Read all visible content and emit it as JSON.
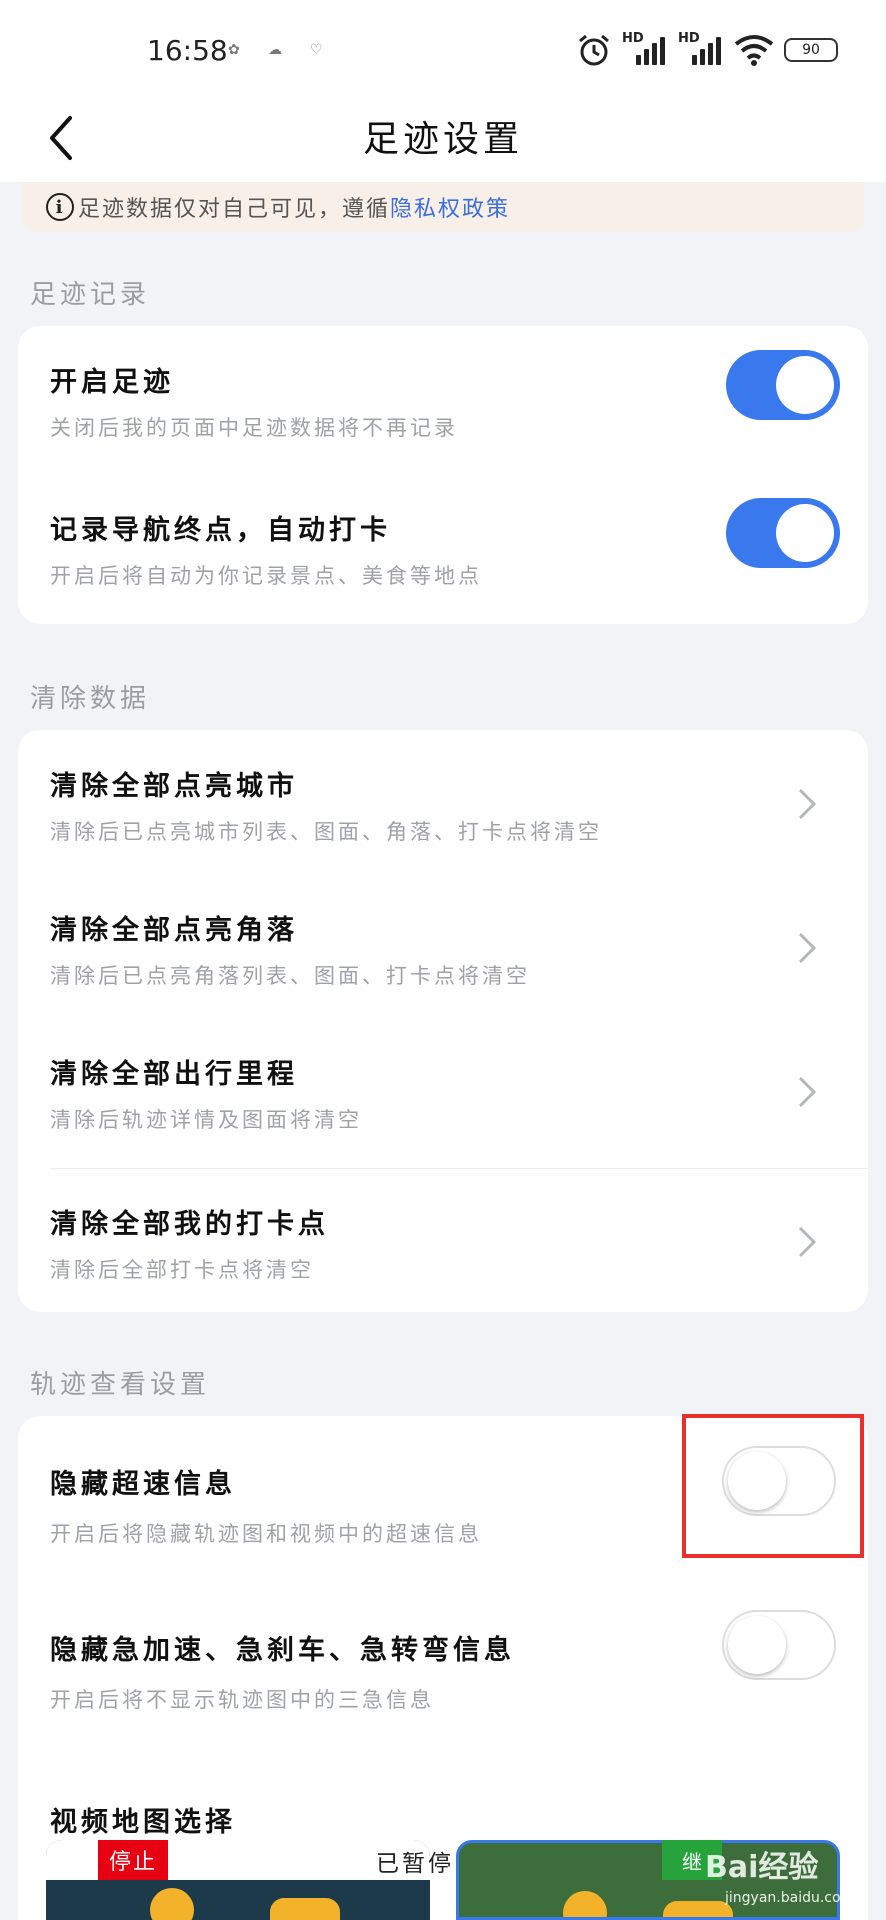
{
  "status_bar": {
    "time": "16:58",
    "hd_label": "HD",
    "battery": "90"
  },
  "header": {
    "title": "足迹设置"
  },
  "notice": {
    "text": "足迹数据仅对自己可见，遵循",
    "link": "隐私权政策"
  },
  "sections": {
    "footprint": {
      "title": "足迹记录",
      "items": [
        {
          "title": "开启足迹",
          "subtitle": "关闭后我的页面中足迹数据将不再记录",
          "toggle": "on"
        },
        {
          "title": "记录导航终点，自动打卡",
          "subtitle": "开启后将自动为你记录景点、美食等地点",
          "toggle": "on"
        }
      ]
    },
    "clear": {
      "title": "清除数据",
      "items": [
        {
          "title": "清除全部点亮城市",
          "subtitle": "清除后已点亮城市列表、图面、角落、打卡点将清空"
        },
        {
          "title": "清除全部点亮角落",
          "subtitle": "清除后已点亮角落列表、图面、打卡点将清空"
        },
        {
          "title": "清除全部出行里程",
          "subtitle": "清除后轨迹详情及图面将清空"
        },
        {
          "title": "清除全部我的打卡点",
          "subtitle": "清除后全部打卡点将清空"
        }
      ]
    },
    "track": {
      "title": "轨迹查看设置",
      "items": [
        {
          "title": "隐藏超速信息",
          "subtitle": "开启后将隐藏轨迹图和视频中的超速信息",
          "toggle": "off"
        },
        {
          "title": "隐藏急加速、急刹车、急转弯信息",
          "subtitle": "开启后将不显示轨迹图中的三急信息",
          "toggle": "off"
        },
        {
          "title": "视频地图选择"
        }
      ]
    }
  },
  "video_thumbs": {
    "stop_label": "停止",
    "paused_label": "已暂停",
    "right_badge": "继"
  },
  "watermark": {
    "brand": "Bai经验",
    "url": "jingyan.baidu.com"
  },
  "colors": {
    "accent": "#3a78ee",
    "highlight": "#e8302f",
    "background": "#f2f3f7"
  }
}
